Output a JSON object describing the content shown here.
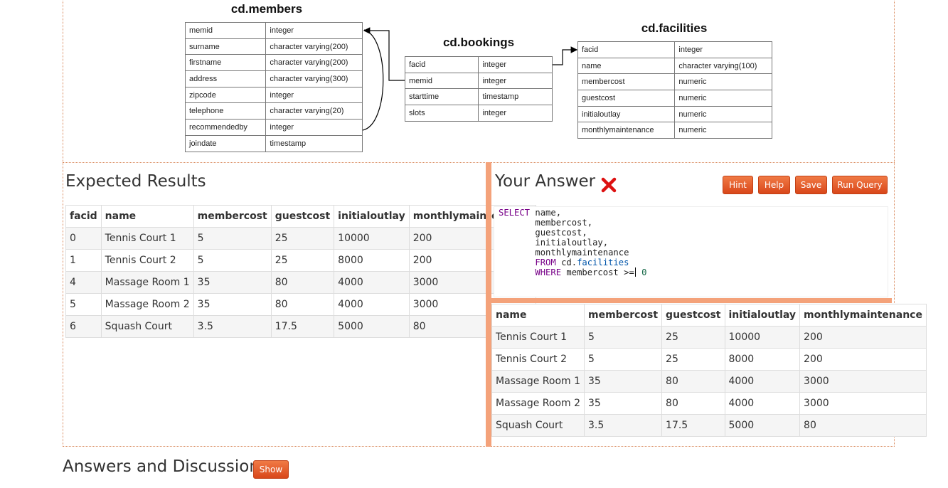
{
  "schema": {
    "members": {
      "title": "cd.members",
      "rows": [
        [
          "memid",
          "integer"
        ],
        [
          "surname",
          "character varying(200)"
        ],
        [
          "firstname",
          "character varying(200)"
        ],
        [
          "address",
          "character varying(300)"
        ],
        [
          "zipcode",
          "integer"
        ],
        [
          "telephone",
          "character varying(20)"
        ],
        [
          "recommendedby",
          "integer"
        ],
        [
          "joindate",
          "timestamp"
        ]
      ]
    },
    "bookings": {
      "title": "cd.bookings",
      "rows": [
        [
          "facid",
          "integer"
        ],
        [
          "memid",
          "integer"
        ],
        [
          "starttime",
          "timestamp"
        ],
        [
          "slots",
          "integer"
        ]
      ]
    },
    "facilities": {
      "title": "cd.facilities",
      "rows": [
        [
          "facid",
          "integer"
        ],
        [
          "name",
          "character varying(100)"
        ],
        [
          "membercost",
          "numeric"
        ],
        [
          "guestcost",
          "numeric"
        ],
        [
          "initialoutlay",
          "numeric"
        ],
        [
          "monthlymaintenance",
          "numeric"
        ]
      ]
    }
  },
  "expected": {
    "title": "Expected Results",
    "columns": [
      "facid",
      "name",
      "membercost",
      "guestcost",
      "initialoutlay",
      "monthlymaintenance"
    ],
    "rows": [
      [
        "0",
        "Tennis Court 1",
        "5",
        "25",
        "10000",
        "200"
      ],
      [
        "1",
        "Tennis Court 2",
        "5",
        "25",
        "8000",
        "200"
      ],
      [
        "4",
        "Massage Room 1",
        "35",
        "80",
        "4000",
        "3000"
      ],
      [
        "5",
        "Massage Room 2",
        "35",
        "80",
        "4000",
        "3000"
      ],
      [
        "6",
        "Squash Court",
        "3.5",
        "17.5",
        "5000",
        "80"
      ]
    ]
  },
  "answer": {
    "title": "Your Answer",
    "status_icon": "red-x-icon",
    "buttons": {
      "hint": "Hint",
      "help": "Help",
      "save": "Save",
      "run": "Run Query"
    },
    "code": {
      "select_kw": "SELECT",
      "line1": " name,",
      "line2": "       membercost,",
      "line3": "       guestcost,",
      "line4": "       initialoutlay,",
      "line5": "       monthlymaintenance",
      "from_indent": "       ",
      "from_kw": "FROM",
      "from_schema": " cd.",
      "from_table": "facilities",
      "where_indent": "       ",
      "where_kw": "WHERE",
      "where_rest": " membercost >=",
      "where_value": " 0"
    },
    "columns": [
      "name",
      "membercost",
      "guestcost",
      "initialoutlay",
      "monthlymaintenance"
    ],
    "rows": [
      [
        "Tennis Court 1",
        "5",
        "25",
        "10000",
        "200"
      ],
      [
        "Tennis Court 2",
        "5",
        "25",
        "8000",
        "200"
      ],
      [
        "Massage Room 1",
        "35",
        "80",
        "4000",
        "3000"
      ],
      [
        "Massage Room 2",
        "35",
        "80",
        "4000",
        "3000"
      ],
      [
        "Squash Court",
        "3.5",
        "17.5",
        "5000",
        "80"
      ]
    ]
  },
  "discussion": {
    "title": "Answers and Discussion",
    "show_button": "Show"
  },
  "colors": {
    "accent": "#e05a2b",
    "splitter": "#f4a27a",
    "frame": "#d98a5e",
    "error": "#dd1111"
  }
}
